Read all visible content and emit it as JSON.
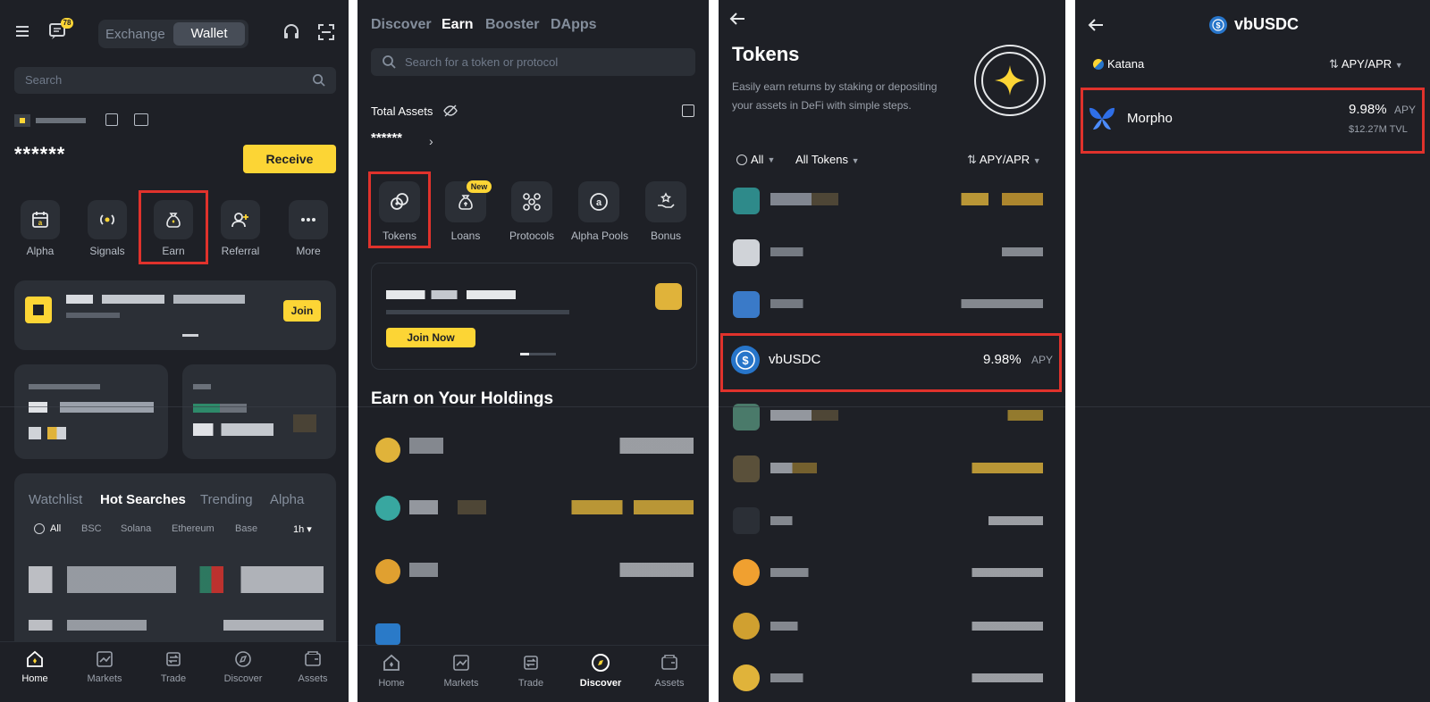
{
  "panel1": {
    "toggle": [
      "Exchange",
      "Wallet"
    ],
    "badge": "78",
    "search_placeholder": "Search",
    "balance": "******",
    "receive": "Receive",
    "shortcuts": [
      "Alpha",
      "Signals",
      "Earn",
      "Referral",
      "More"
    ],
    "join": "Join",
    "market_tabs": [
      "Watchlist",
      "Hot Searches",
      "Trending",
      "Alpha"
    ],
    "chains": [
      "All",
      "BSC",
      "Solana",
      "Ethereum",
      "Base"
    ],
    "timeframe": "1h",
    "nav": [
      "Home",
      "Markets",
      "Trade",
      "Discover",
      "Assets"
    ]
  },
  "panel2": {
    "top_tabs": [
      "Discover",
      "Earn",
      "Booster",
      "DApps"
    ],
    "search_placeholder": "Search for a token or protocol",
    "total_assets_label": "Total Assets",
    "total_assets_value": "******",
    "categories": [
      "Tokens",
      "Loans",
      "Protocols",
      "Alpha Pools",
      "Bonus"
    ],
    "new_badge": "New",
    "join_now": "Join Now",
    "section_title": "Earn on Your Holdings",
    "nav": [
      "Home",
      "Markets",
      "Trade",
      "Discover",
      "Assets"
    ]
  },
  "panel3": {
    "title": "Tokens",
    "subtitle_line1": "Easily earn returns by staking or depositing",
    "subtitle_line2": "your assets in DeFi with simple steps.",
    "filter_all": "All",
    "filter_tokens": "All Tokens",
    "sort": "APY/APR",
    "highlight_token": "vbUSDC",
    "highlight_rate": "9.98%",
    "highlight_unit": "APY"
  },
  "panel4": {
    "title": "vbUSDC",
    "network": "Katana",
    "sort": "APY/APR",
    "protocol": "Morpho",
    "rate": "9.98%",
    "rate_unit": "APY",
    "tvl": "$12.27M TVL"
  },
  "colors": {
    "bg": "#1e2026",
    "card": "#2b2f36",
    "accent": "#fcd535",
    "highlight": "#e0322c",
    "usdc": "#2775ca"
  }
}
